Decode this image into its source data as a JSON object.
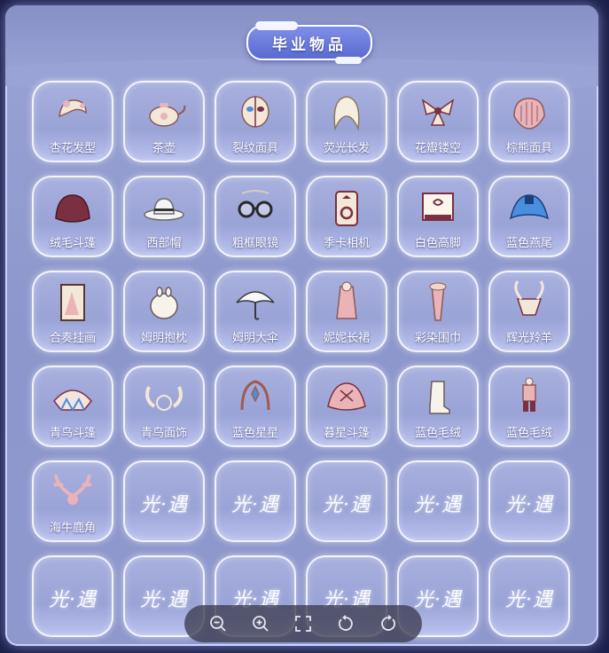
{
  "title": "毕业物品",
  "items": [
    {
      "label": "杏花发型",
      "icon": "hair-icon"
    },
    {
      "label": "茶壶",
      "icon": "teapot-icon"
    },
    {
      "label": "裂纹面具",
      "icon": "mask-icon"
    },
    {
      "label": "荧光长发",
      "icon": "long-hair-icon"
    },
    {
      "label": "花瓣镂空",
      "icon": "petal-hair-icon"
    },
    {
      "label": "棕熊面具",
      "icon": "bear-mask-icon"
    },
    {
      "label": "绒毛斗篷",
      "icon": "fluffy-cape-icon"
    },
    {
      "label": "西部帽",
      "icon": "cowboy-hat-icon"
    },
    {
      "label": "粗框眼镜",
      "icon": "glasses-icon"
    },
    {
      "label": "季卡相机",
      "icon": "camera-icon"
    },
    {
      "label": "白色高脚",
      "icon": "piano-icon"
    },
    {
      "label": "蓝色燕尾",
      "icon": "blue-cape-icon"
    },
    {
      "label": "合奏挂画",
      "icon": "painting-icon"
    },
    {
      "label": "姆明抱枕",
      "icon": "moomin-pillow-icon"
    },
    {
      "label": "姆明大伞",
      "icon": "umbrella-icon"
    },
    {
      "label": "妮妮长裙",
      "icon": "dress-icon"
    },
    {
      "label": "彩染围巾",
      "icon": "scarf-icon"
    },
    {
      "label": "辉光羚羊",
      "icon": "antelope-mask-icon"
    },
    {
      "label": "青鸟斗篷",
      "icon": "bluebird-cape-icon"
    },
    {
      "label": "青鸟面饰",
      "icon": "bluebird-mask-icon"
    },
    {
      "label": "蓝色星星",
      "icon": "star-headpiece-icon"
    },
    {
      "label": "暮星斗篷",
      "icon": "dusk-cape-icon"
    },
    {
      "label": "蓝色毛绒",
      "icon": "fluffy-boots-icon"
    },
    {
      "label": "蓝色毛绒",
      "icon": "fluffy-outfit-icon"
    },
    {
      "label": "海牛鹿角",
      "icon": "antler-icon"
    }
  ],
  "empty_slot_logo": "光·遇",
  "empty_slot_count": 11,
  "toolbar": [
    {
      "name": "zoom-out-button",
      "icon": "zoom-out-icon"
    },
    {
      "name": "zoom-in-button",
      "icon": "zoom-in-icon"
    },
    {
      "name": "fullscreen-button",
      "icon": "fullscreen-icon"
    },
    {
      "name": "rotate-left-button",
      "icon": "rotate-left-icon"
    },
    {
      "name": "rotate-right-button",
      "icon": "rotate-right-icon"
    }
  ],
  "colors": {
    "panel": "#9aa3d6",
    "title_pill": "#6676dc",
    "icon_pink": "#e9b3b8",
    "icon_maroon": "#7a3040",
    "icon_blue": "#4a8ee0",
    "icon_cream": "#f3e7d7"
  }
}
